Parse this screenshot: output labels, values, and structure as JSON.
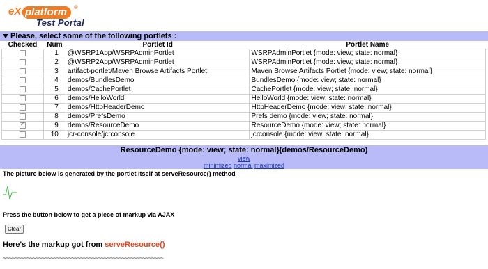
{
  "header": {
    "logo_exo": "eXo",
    "logo_platform": "platform",
    "logo_reg": "®",
    "portal_title": "Test Portal"
  },
  "section": {
    "title": "Please, select some of the following portlets :"
  },
  "table": {
    "headers": {
      "checked": "Checked",
      "num": "Num",
      "portlet_id": "Portlet Id",
      "portlet_name": "Portlet Name"
    },
    "rows": [
      {
        "checked": false,
        "num": "1",
        "id": "@WSRP1App/WSRPAdminPortlet",
        "name": "WSRPAdminPortlet {mode: view; state: normal}"
      },
      {
        "checked": false,
        "num": "2",
        "id": "@WSRP2App/WSRPAdminPortlet",
        "name": "WSRPAdminPortlet {mode: view; state: normal}"
      },
      {
        "checked": false,
        "num": "3",
        "id": "artifact-portlet/Maven Browse Artifacts Portlet",
        "name": "Maven Browse Artifacts Portlet {mode: view; state: normal}"
      },
      {
        "checked": false,
        "num": "4",
        "id": "demos/BundlesDemo",
        "name": "BundlesDemo {mode: view; state: normal}"
      },
      {
        "checked": false,
        "num": "5",
        "id": "demos/CachePortlet",
        "name": "CachePortlet {mode: view; state: normal}"
      },
      {
        "checked": false,
        "num": "6",
        "id": "demos/HelloWorld",
        "name": "HelloWorld {mode: view; state: normal}"
      },
      {
        "checked": false,
        "num": "7",
        "id": "demos/HttpHeaderDemo",
        "name": "HttpHeaderDemo {mode: view; state: normal}"
      },
      {
        "checked": false,
        "num": "8",
        "id": "demos/PrefsDemo",
        "name": "Prefs demo {mode: view; state: normal}"
      },
      {
        "checked": true,
        "num": "9",
        "id": "demos/ResourceDemo",
        "name": "ResourceDemo {mode: view; state: normal}"
      },
      {
        "checked": false,
        "num": "10",
        "id": "jcr-console/jcrconsole",
        "name": "jcrconsole {mode: view; state: normal}"
      }
    ]
  },
  "window": {
    "title": "ResourceDemo {mode: view; state: normal}(demos/ResourceDemo)",
    "mode_link": "view",
    "state_minimized": "minimized",
    "state_normal": "normal",
    "state_maximized": "maximized"
  },
  "content": {
    "picture_text": "The picture below is generated by the portlet itself at serveResource() method",
    "button_text": "Press the button below to get a piece of markup via AJAX",
    "clear_label": "Clear",
    "markup_prefix": "Here's the markup got from ",
    "markup_method": "serveResource()",
    "tilde_line": "~~~~~~~~~~~~~~~~~~~~~~~~~~~~~~~~~~~~~~~~~~~~~~~~~~~~~~"
  },
  "colors": {
    "bar": "#b8bbf7",
    "logo_orange": "#f27a1f",
    "link_blue": "#1a38c9",
    "accent_red": "#e8431b",
    "wave_green": "#3ab54a"
  }
}
